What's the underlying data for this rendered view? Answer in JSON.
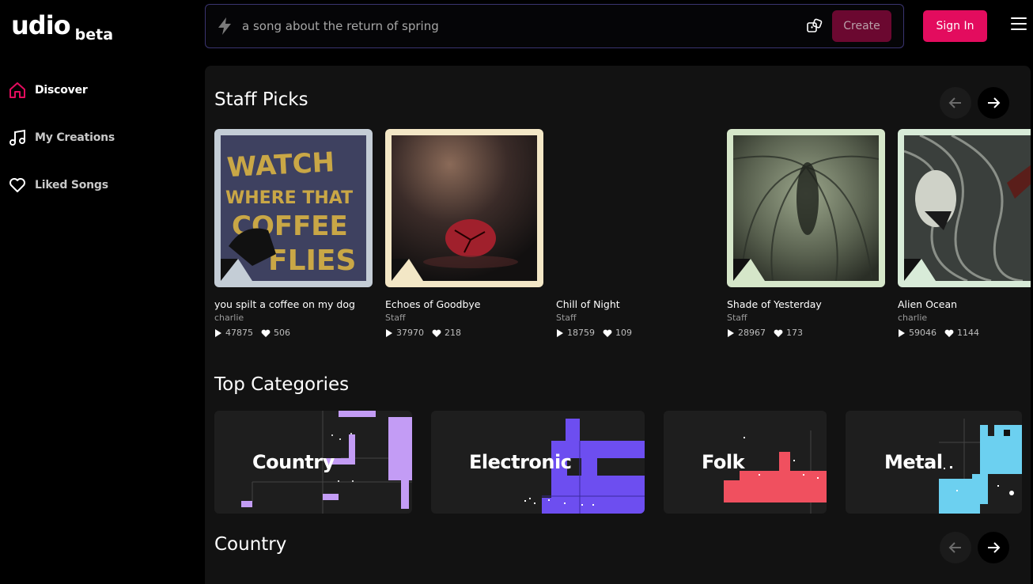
{
  "brand": {
    "name": "udio",
    "badge": "beta"
  },
  "sidebar": {
    "items": [
      {
        "label": "Discover",
        "icon": "home-icon",
        "active": true
      },
      {
        "label": "My Creations",
        "icon": "music-note-icon",
        "active": false
      },
      {
        "label": "Liked Songs",
        "icon": "heart-icon",
        "active": false
      }
    ]
  },
  "search": {
    "placeholder": "a song about the return of spring",
    "create_label": "Create"
  },
  "header": {
    "signin_label": "Sign In"
  },
  "staff_picks": {
    "title": "Staff Picks",
    "cards": [
      {
        "title": "you spilt a coffee on my dog",
        "artist": "charlie",
        "plays": "47875",
        "likes": "506",
        "frame_color": "#c4cdd6"
      },
      {
        "title": "Echoes of Goodbye",
        "artist": "Staff",
        "plays": "37970",
        "likes": "218",
        "frame_color": "#f3e7c6"
      },
      {
        "title": "Chill of Night",
        "artist": "Staff",
        "plays": "18759",
        "likes": "109",
        "frame_color": ""
      },
      {
        "title": "Shade of Yesterday",
        "artist": "Staff",
        "plays": "28967",
        "likes": "173",
        "frame_color": "#d5e6c9"
      },
      {
        "title": "Alien Ocean",
        "artist": "charlie",
        "plays": "59046",
        "likes": "1144",
        "frame_color": "#d8ebd8"
      }
    ]
  },
  "top_categories": {
    "title": "Top Categories",
    "items": [
      {
        "name": "Country",
        "color": "#c39cf5"
      },
      {
        "name": "Electronic",
        "color": "#6d4ef0"
      },
      {
        "name": "Folk",
        "color": "#f0505f"
      },
      {
        "name": "Metal",
        "color": "#6cd0f0"
      }
    ]
  },
  "country_section": {
    "title": "Country"
  }
}
